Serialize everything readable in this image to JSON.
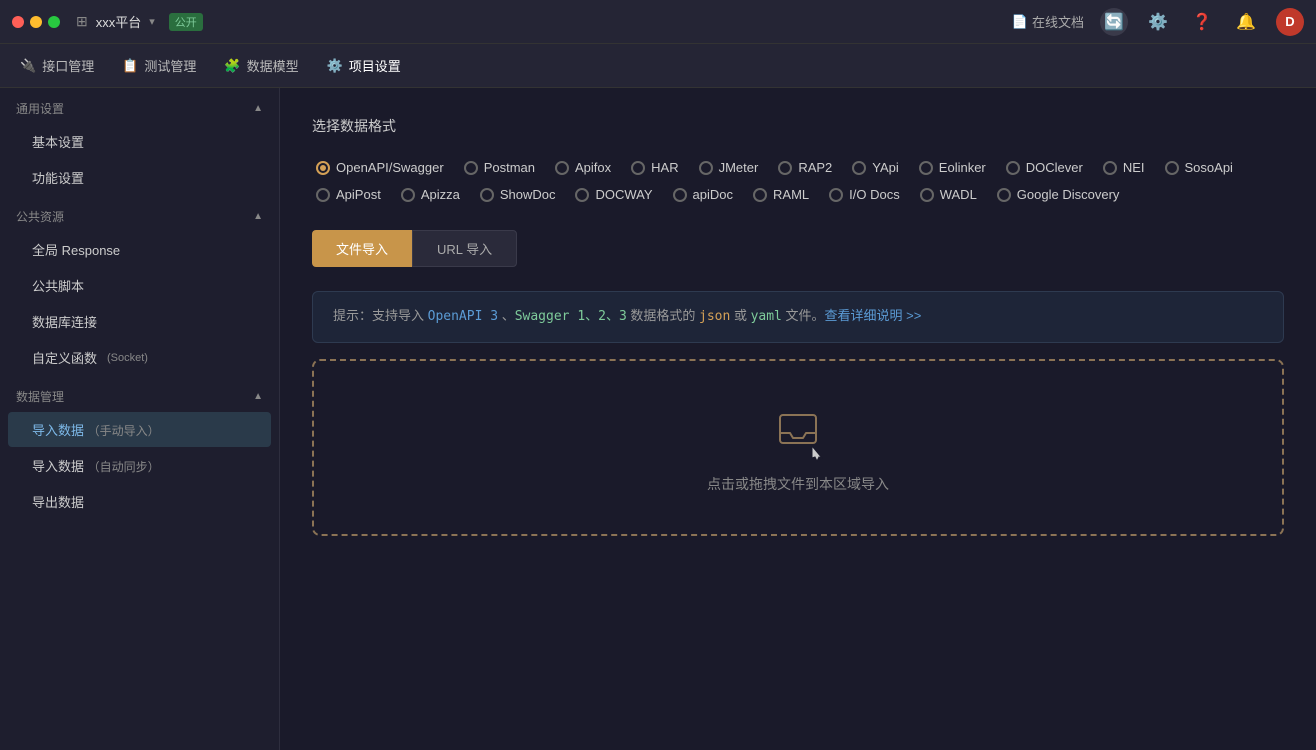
{
  "titlebar": {
    "app_name": "xxx平台",
    "badge": "公开",
    "online_doc": "在线文档",
    "user_initial": "D"
  },
  "navbar": {
    "items": [
      {
        "id": "interface",
        "icon": "🔌",
        "label": "接口管理"
      },
      {
        "id": "test",
        "icon": "📋",
        "label": "测试管理"
      },
      {
        "id": "model",
        "icon": "🧩",
        "label": "数据模型"
      },
      {
        "id": "project",
        "icon": "⚙️",
        "label": "项目设置"
      }
    ]
  },
  "sidebar": {
    "sections": [
      {
        "id": "general",
        "label": "通用设置",
        "items": [
          {
            "id": "basic",
            "label": "基本设置"
          },
          {
            "id": "feature",
            "label": "功能设置"
          }
        ]
      },
      {
        "id": "public",
        "label": "公共资源",
        "items": [
          {
            "id": "global-response",
            "label": "全局 Response"
          },
          {
            "id": "public-script",
            "label": "公共脚本"
          },
          {
            "id": "db-connection",
            "label": "数据库连接"
          },
          {
            "id": "custom-func",
            "label": "自定义函数",
            "badge": "(Socket)"
          }
        ]
      },
      {
        "id": "data-mgmt",
        "label": "数据管理",
        "items": [
          {
            "id": "import-manual",
            "label": "导入数据",
            "badge": "（手动导入）"
          },
          {
            "id": "import-auto",
            "label": "导入数据",
            "badge": "（自动同步）"
          },
          {
            "id": "export",
            "label": "导出数据"
          }
        ]
      }
    ]
  },
  "content": {
    "section_title": "选择数据格式",
    "formats_row1": [
      {
        "id": "openapi",
        "label": "OpenAPI/Swagger",
        "checked": true
      },
      {
        "id": "postman",
        "label": "Postman",
        "checked": false
      },
      {
        "id": "apifox",
        "label": "Apifox",
        "checked": false
      },
      {
        "id": "har",
        "label": "HAR",
        "checked": false
      },
      {
        "id": "jmeter",
        "label": "JMeter",
        "checked": false
      },
      {
        "id": "rap2",
        "label": "RAP2",
        "checked": false
      },
      {
        "id": "yapi",
        "label": "YApi",
        "checked": false
      },
      {
        "id": "eolinker",
        "label": "Eolinker",
        "checked": false
      },
      {
        "id": "doclever",
        "label": "DOClever",
        "checked": false
      },
      {
        "id": "nei",
        "label": "NEI",
        "checked": false
      },
      {
        "id": "sosoapi",
        "label": "SosoApi",
        "checked": false
      }
    ],
    "formats_row2": [
      {
        "id": "apipost",
        "label": "ApiPost",
        "checked": false
      },
      {
        "id": "apizza",
        "label": "Apizza",
        "checked": false
      },
      {
        "id": "showdoc",
        "label": "ShowDoc",
        "checked": false
      },
      {
        "id": "docway",
        "label": "DOCWAY",
        "checked": false
      },
      {
        "id": "apidoc",
        "label": "apiDoc",
        "checked": false
      },
      {
        "id": "raml",
        "label": "RAML",
        "checked": false
      },
      {
        "id": "iodocs",
        "label": "I/O Docs",
        "checked": false
      },
      {
        "id": "wadl",
        "label": "WADL",
        "checked": false
      },
      {
        "id": "google",
        "label": "Google Discovery",
        "checked": false
      }
    ],
    "tab_file": "文件导入",
    "tab_url": "URL 导入",
    "hint_prefix": "提示：支持导入",
    "hint_format1": "OpenAPI 3",
    "hint_sep1": "、",
    "hint_format2": "Swagger 1、2、3",
    "hint_mid": "数据格式的",
    "hint_json": "json",
    "hint_or": "或",
    "hint_yaml": "yaml",
    "hint_suffix": "文件。",
    "hint_link": "查看详细说明 >>",
    "drop_text": "点击或拖拽文件到本区域导入"
  }
}
